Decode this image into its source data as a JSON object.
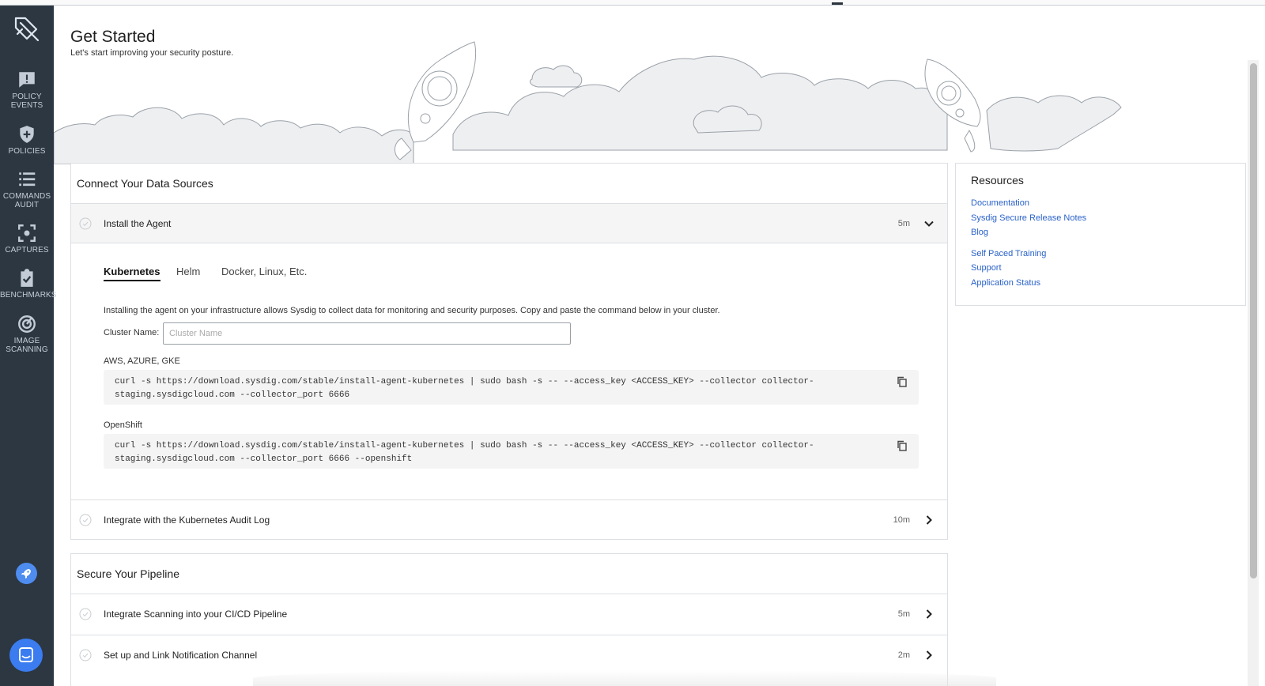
{
  "sidebar": {
    "items": [
      {
        "label": "POLICY\nEVENTS",
        "icon": "alert-message-icon"
      },
      {
        "label": "POLICIES",
        "icon": "shield-icon"
      },
      {
        "label": "COMMANDS\nAUDIT",
        "icon": "list-icon"
      },
      {
        "label": "CAPTURES",
        "icon": "capture-icon"
      },
      {
        "label": "BENCHMARKS",
        "icon": "clipboard-check-icon"
      },
      {
        "label": "IMAGE\nSCANNING",
        "icon": "radar-icon"
      }
    ],
    "colors": {
      "background": "#2c3742",
      "text": "#c3ccd6",
      "accent": "#4e8cf0"
    }
  },
  "header": {
    "title": "Get Started",
    "subtitle": "Let's start improving your security posture."
  },
  "connect": {
    "title": "Connect Your Data Sources",
    "install": {
      "label": "Install the Agent",
      "duration": "5m",
      "expanded": true
    },
    "tabs": [
      "Kubernetes",
      "Helm",
      "Docker, Linux, Etc."
    ],
    "active_tab": "Kubernetes",
    "description": "Installing the agent on your infrastructure allows Sysdig to collect data for monitoring and security purposes. Copy and paste the command below in your cluster.",
    "cluster_label": "Cluster Name:",
    "cluster_placeholder": "Cluster Name",
    "env1": {
      "label": "AWS, AZURE, GKE",
      "command": "curl -s https://download.sysdig.com/stable/install-agent-kubernetes | sudo bash -s -- --access_key <ACCESS_KEY> --collector collector-\nstaging.sysdigcloud.com --collector_port 6666"
    },
    "env2": {
      "label": "OpenShift",
      "command": "curl -s https://download.sysdig.com/stable/install-agent-kubernetes | sudo bash -s -- --access_key <ACCESS_KEY> --collector collector-\nstaging.sysdigcloud.com --collector_port 6666 --openshift"
    },
    "audit": {
      "label": "Integrate with the Kubernetes Audit Log",
      "duration": "10m"
    }
  },
  "pipeline": {
    "title": "Secure Your Pipeline",
    "rows": [
      {
        "label": "Integrate Scanning into your CI/CD Pipeline",
        "duration": "5m"
      },
      {
        "label": "Set up and Link Notification Channel",
        "duration": "2m"
      }
    ]
  },
  "resources": {
    "title": "Resources",
    "links": [
      "Documentation",
      "Sysdig Secure Release Notes",
      "Blog",
      "Self Paced Training",
      "Support",
      "Application Status"
    ],
    "link_color": "#2a62c9"
  }
}
